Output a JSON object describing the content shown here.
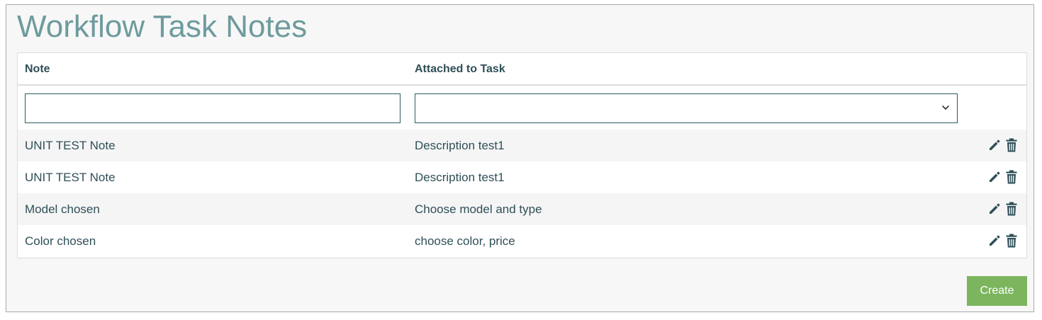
{
  "page": {
    "title": "Workflow Task Notes"
  },
  "table": {
    "columns": {
      "note": "Note",
      "task": "Attached to Task"
    },
    "filters": {
      "note_value": "",
      "note_placeholder": "",
      "task_selected": ""
    },
    "rows": [
      {
        "note": "UNIT TEST Note",
        "task": "Description test1"
      },
      {
        "note": "UNIT TEST Note",
        "task": "Description test1"
      },
      {
        "note": "Model chosen",
        "task": "Choose model and type"
      },
      {
        "note": "Color chosen",
        "task": "choose color, price"
      }
    ],
    "row_actions": [
      "pencil-icon",
      "trash-icon"
    ]
  },
  "actions": {
    "create_label": "Create"
  },
  "colors": {
    "title": "#6e9b9d",
    "text": "#2f4f57",
    "input_border": "#2e5a63",
    "row_alt": "#f5f5f5",
    "create_button": "#7cb55e"
  }
}
